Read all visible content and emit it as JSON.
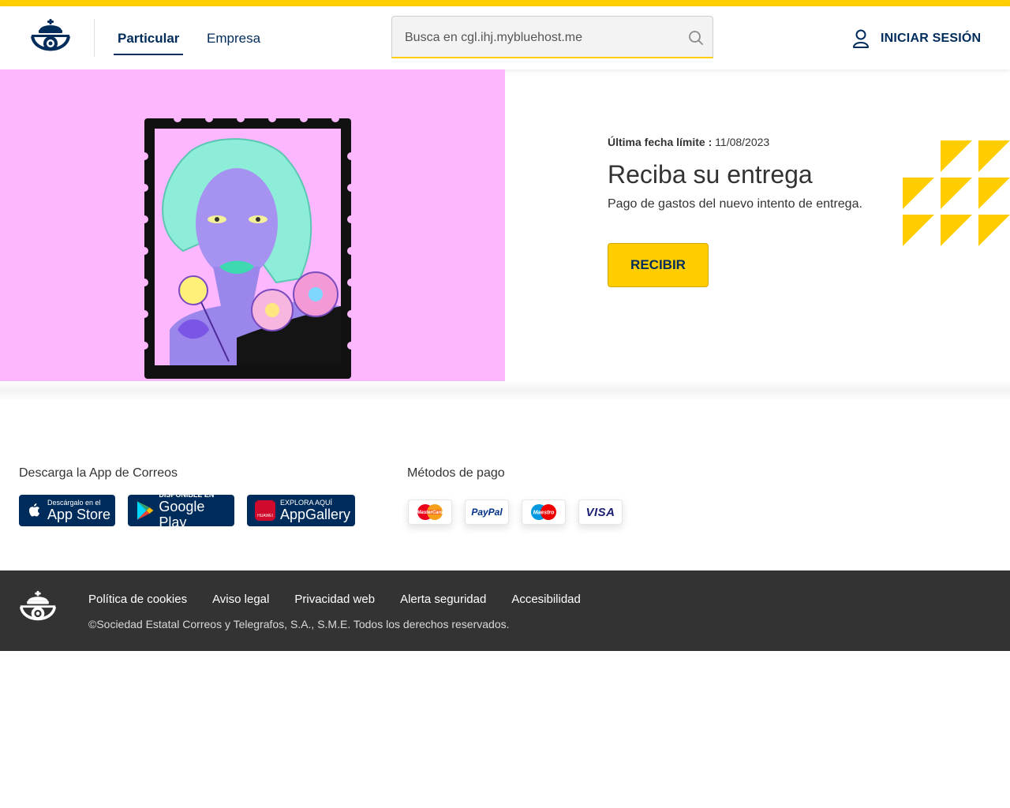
{
  "colors": {
    "brand_yellow": "#FFCD00",
    "brand_navy": "#002C5B",
    "hero_pink": "#FDB7FE",
    "footer_bg": "#333333"
  },
  "header": {
    "logo_icon": "correos-crown-horn-icon",
    "nav": {
      "particular": "Particular",
      "empresa": "Empresa"
    },
    "search": {
      "placeholder": "Busca en cgl.ihj.mybluehost.me",
      "icon": "search-icon"
    },
    "login": {
      "label": "INICIAR SESIÓN",
      "icon": "user-icon"
    }
  },
  "hero": {
    "image": "stamp-illustration-woman-flowers",
    "deadline_label": "Última fecha límite :",
    "deadline_value": "11/08/2023",
    "title": "Reciba su entrega",
    "subtitle": "Pago de gastos del nuevo intento de entrega.",
    "button": "RECIBIR"
  },
  "apps": {
    "title": "Descarga la App de Correos",
    "stores": [
      {
        "small": "Descárgalo en el",
        "big": "App Store",
        "icon": "apple-icon"
      },
      {
        "small": "DISPONIBLE EN",
        "big": "Google Play",
        "icon": "google-play-icon"
      },
      {
        "small": "EXPLORA AQUÍ",
        "big": "AppGallery",
        "icon": "huawei-icon",
        "badge": "HUAWEI"
      }
    ]
  },
  "payments": {
    "title": "Métodos de pago",
    "methods": [
      {
        "name": "MasterCard",
        "icon": "mastercard-icon"
      },
      {
        "name": "PayPal",
        "icon": "paypal-icon"
      },
      {
        "name": "Maestro",
        "icon": "maestro-icon"
      },
      {
        "name": "VISA",
        "icon": "visa-icon"
      }
    ]
  },
  "footer": {
    "links": [
      "Política de cookies",
      "Aviso legal",
      "Privacidad web",
      "Alerta seguridad",
      "Accesibilidad"
    ],
    "copyright": "©Sociedad Estatal Correos y Telegrafos, S.A., S.M.E. Todos los derechos reservados."
  }
}
